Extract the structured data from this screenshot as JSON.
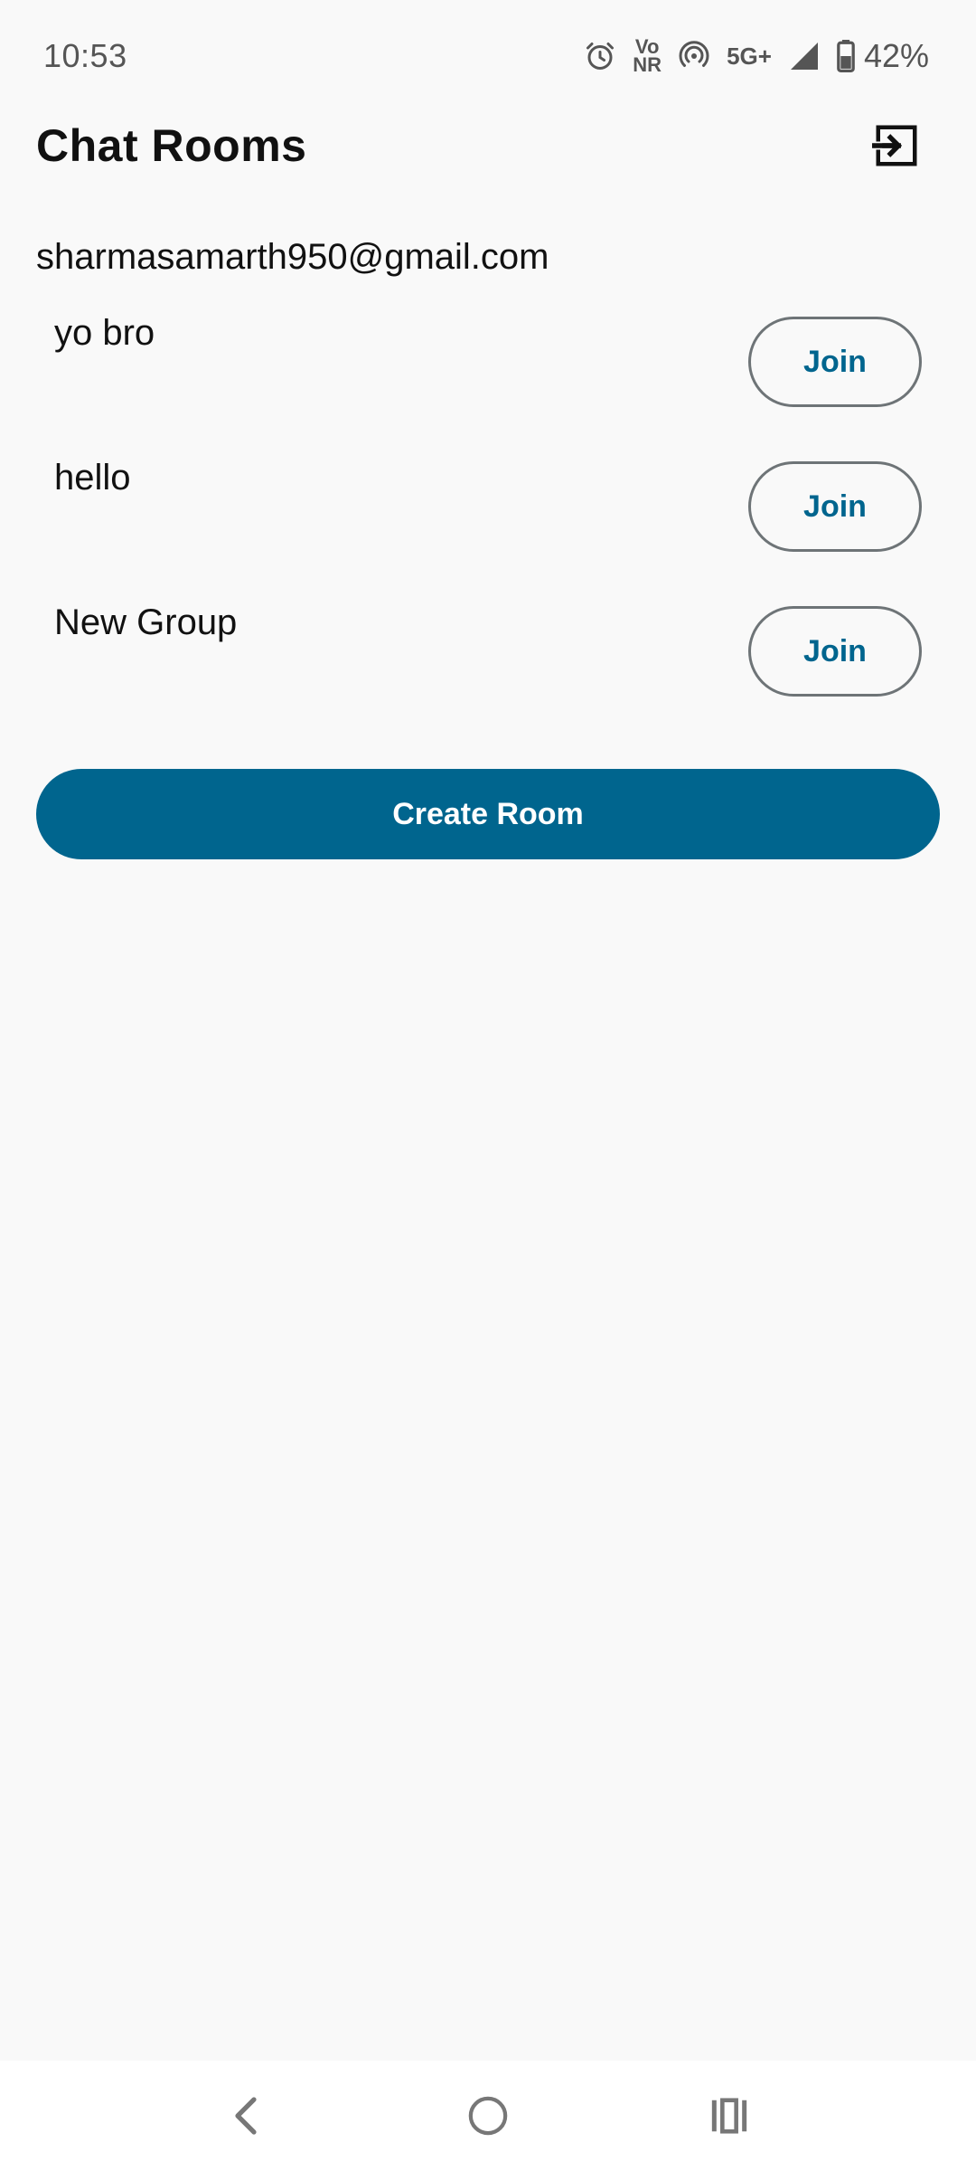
{
  "status_bar": {
    "time": "10:53",
    "volte_top": "Vo",
    "volte_bottom": "NR",
    "network": "5G+",
    "battery": "42%"
  },
  "header": {
    "title": "Chat Rooms",
    "logout_icon": "logout-icon"
  },
  "user": {
    "email": "sharmasamarth950@gmail.com"
  },
  "rooms": [
    {
      "name": "yo bro",
      "action": "Join"
    },
    {
      "name": "hello",
      "action": "Join"
    },
    {
      "name": "New Group",
      "action": "Join"
    }
  ],
  "actions": {
    "create_room": "Create Room"
  },
  "colors": {
    "accent": "#00658e",
    "background": "#f9f9f9",
    "outline": "#6e7477"
  },
  "nav": {
    "back_icon": "back-icon",
    "home_icon": "home-icon",
    "recents_icon": "recents-icon"
  }
}
